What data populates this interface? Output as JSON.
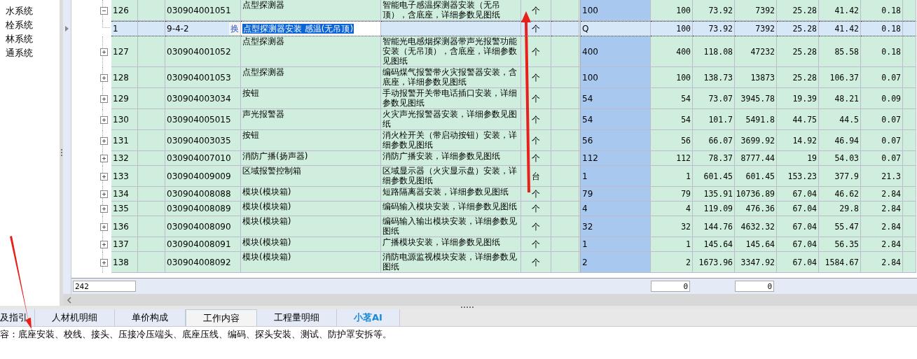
{
  "sidebar": {
    "items": [
      "水系统",
      "栓系统",
      "林系统",
      "通系统"
    ]
  },
  "table": {
    "rows": [
      {
        "no": "126",
        "code": "030904001051",
        "name": "点型探测器",
        "desc": "智能电子感温探测器安装（无吊顶），含底座，详细参数见图纸",
        "unit": "个",
        "qty": "100",
        "values": [
          "100",
          "73.92",
          "7392",
          "25.28",
          "41.42",
          "0.18"
        ],
        "expanded": true,
        "children": [
          {
            "no": "1",
            "code": "9-4-2",
            "action": "换",
            "name": "点型探测器安装 感温(无吊顶)",
            "unit": "个",
            "qty": "Q",
            "values": [
              "100",
              "73.92",
              "7392",
              "25.28",
              "41.42",
              "0.18"
            ],
            "selected": true
          }
        ]
      },
      {
        "no": "127",
        "code": "030904001052",
        "name": "点型探测器",
        "desc": "智能光电感烟探测器带声光报警功能安装（无吊顶），含底座，详细参数见图纸",
        "unit": "个",
        "qty": "400",
        "values": [
          "400",
          "118.08",
          "47232",
          "25.28",
          "85.58",
          "0.18"
        ],
        "expanded": false
      },
      {
        "no": "128",
        "code": "030904001053",
        "name": "点型探测器",
        "desc": "编码煤气报警带火灾报警器安装，含底座，详细参数见图纸",
        "unit": "个",
        "qty": "100",
        "values": [
          "100",
          "138.73",
          "13873",
          "25.28",
          "106.37",
          "0.07"
        ],
        "expanded": false
      },
      {
        "no": "129",
        "code": "030904003034",
        "name": "按钮",
        "desc": "手动报警开关带电话插口安装，详细参数见图纸",
        "unit": "个",
        "qty": "54",
        "values": [
          "54",
          "73.07",
          "3945.78",
          "19.39",
          "48.21",
          "0.09"
        ],
        "expanded": false
      },
      {
        "no": "130",
        "code": "030904005015",
        "name": "声光报警器",
        "desc": "火灾声光报警器安装，详细参数见图纸",
        "unit": "个",
        "qty": "54",
        "values": [
          "54",
          "101.7",
          "5491.8",
          "44.75",
          "44.5",
          "0.07"
        ],
        "expanded": false
      },
      {
        "no": "131",
        "code": "030904003035",
        "name": "按钮",
        "desc": "消火栓开关（带启动按钮）安装，详细参数见图纸",
        "unit": "个",
        "qty": "56",
        "values": [
          "56",
          "66.07",
          "3699.92",
          "14.92",
          "46.94",
          "0.07"
        ],
        "expanded": false
      },
      {
        "no": "132",
        "code": "030904007010",
        "name": "消防广播(扬声器)",
        "desc": "消防广播安装，详细参数见图纸",
        "unit": "个",
        "qty": "112",
        "values": [
          "112",
          "78.37",
          "8777.44",
          "19",
          "54.03",
          "0.07"
        ],
        "expanded": false
      },
      {
        "no": "133",
        "code": "030904009009",
        "name": "区域报警控制箱",
        "desc": "区域显示器（火灾显示盘）安装，详细参数见图纸",
        "unit": "台",
        "qty": "1",
        "values": [
          "1",
          "601.45",
          "601.45",
          "153.23",
          "377.9",
          "21.3"
        ],
        "expanded": false
      },
      {
        "no": "134",
        "code": "030904008088",
        "name": "模块(模块箱)",
        "desc": "短路隔离器安装，详细参数见图纸",
        "unit": "个",
        "qty": "79",
        "values": [
          "79",
          "135.91",
          "10736.89",
          "67.04",
          "46.62",
          "2.84"
        ],
        "expanded": false
      },
      {
        "no": "135",
        "code": "030904008089",
        "name": "模块(模块箱)",
        "desc": "编码输入模块安装，详细参数见图纸",
        "unit": "个",
        "qty": "4",
        "values": [
          "4",
          "119.09",
          "476.36",
          "67.04",
          "29.8",
          "2.84"
        ],
        "expanded": false
      },
      {
        "no": "136",
        "code": "030904008090",
        "name": "模块(模块箱)",
        "desc": "编码输入输出模块安装，详细参数见图纸",
        "unit": "个",
        "qty": "32",
        "values": [
          "32",
          "144.76",
          "4632.32",
          "67.04",
          "55.47",
          "2.84"
        ],
        "expanded": false
      },
      {
        "no": "137",
        "code": "030904008091",
        "name": "模块(模块箱)",
        "desc": "广播模块安装，详细参数见图纸",
        "unit": "个",
        "qty": "1",
        "values": [
          "1",
          "145.64",
          "145.64",
          "67.04",
          "56.35",
          "2.84"
        ],
        "expanded": false
      },
      {
        "no": "138",
        "code": "030904008092",
        "name": "模块(模块箱)",
        "desc": "消防电源监视模块安装，详细参数见图纸",
        "unit": "个",
        "qty": "2",
        "values": [
          "2",
          "1673.96",
          "3347.92",
          "67.04",
          "1584.67",
          "2.84"
        ],
        "expanded": false
      }
    ],
    "footer": {
      "count": "242",
      "totals": [
        "0",
        "0"
      ]
    }
  },
  "tabs": [
    {
      "label": "及指引",
      "selected": false,
      "kind": "plain"
    },
    {
      "label": "人材机明细",
      "selected": false,
      "kind": "plain"
    },
    {
      "label": "单价构成",
      "selected": false,
      "kind": "plain"
    },
    {
      "label": "工作内容",
      "selected": true,
      "kind": "plain"
    },
    {
      "label": "工程量明细",
      "selected": false,
      "kind": "plain"
    },
    {
      "label": "小茗AI",
      "selected": false,
      "kind": "ai"
    }
  ],
  "content": "容：底座安装、校线、接头、压接冷压端头、底座压线、编码、探头安装、测试、防护罩安拆等。"
}
